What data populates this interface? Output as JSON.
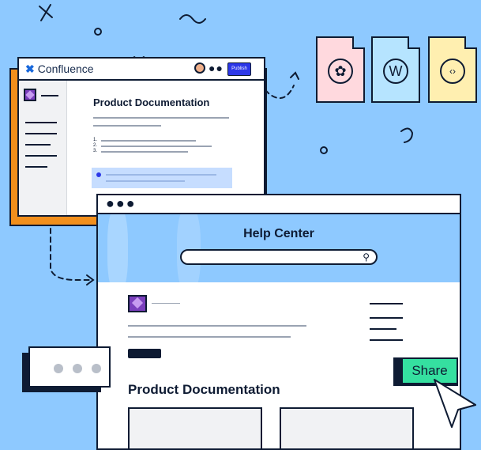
{
  "confluence": {
    "brand": "Confluence",
    "publish_label": "Publish",
    "doc_title": "Product Documentation",
    "list_numbers": [
      "1.",
      "2.",
      "3."
    ]
  },
  "files": [
    {
      "name": "pdf-file",
      "color": "#ffd9de",
      "glyph": "❀"
    },
    {
      "name": "word-file",
      "color": "#b6e4ff",
      "glyph": "W"
    },
    {
      "name": "code-file",
      "color": "#ffefb0",
      "glyph": "‹›"
    }
  ],
  "help_center": {
    "title": "Help Center",
    "search_icon": "⚲",
    "doc_title": "Product Documentation"
  },
  "share": {
    "label": "Share"
  },
  "colors": {
    "background": "#8ec9ff",
    "confluence_frame": "#f28f1c",
    "publish_button": "#2d38e8",
    "share_button": "#35e0a0",
    "logo_purple": "#7b3fbd"
  }
}
